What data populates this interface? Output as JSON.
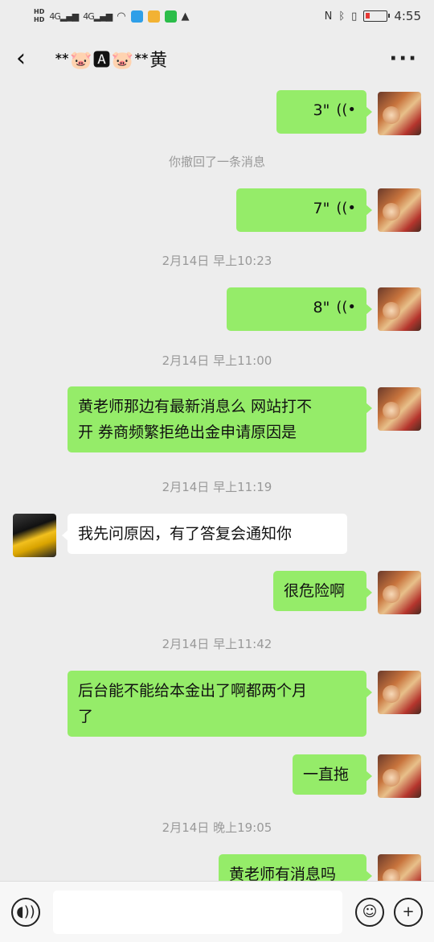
{
  "status_bar": {
    "hd_top": "HD",
    "hd_bottom": "HD",
    "net1": "4G",
    "net2": "4G",
    "nfc": "N",
    "bt": "ᛒ",
    "vibrate": "▯",
    "time": "4:55"
  },
  "header": {
    "title": "ᕯ🐷🅰🐷ᕯ黄"
  },
  "messages": [
    {
      "kind": "voice",
      "from": "me",
      "duration": "3\""
    },
    {
      "kind": "system",
      "text": "你撤回了一条消息"
    },
    {
      "kind": "voice",
      "from": "me",
      "duration": "7\""
    },
    {
      "kind": "system",
      "text": "2月14日 早上10:23"
    },
    {
      "kind": "voice",
      "from": "me",
      "duration": "8\""
    },
    {
      "kind": "system",
      "text": "2月14日 早上11:00"
    },
    {
      "kind": "text",
      "from": "me",
      "lines": [
        "黄老师那边有最新消息么 网站打不",
        "开 券商频繁拒绝出金申请原因是"
      ]
    },
    {
      "kind": "system",
      "text": "2月14日 早上11:19"
    },
    {
      "kind": "text",
      "from": "other",
      "lines": [
        "我先问原因，有了答复会通知你"
      ]
    },
    {
      "kind": "text",
      "from": "me",
      "lines": [
        "很危险啊"
      ]
    },
    {
      "kind": "system",
      "text": "2月14日 早上11:42"
    },
    {
      "kind": "text",
      "from": "me",
      "lines": [
        "后台能不能给本金出了啊都两个月",
        "了"
      ]
    },
    {
      "kind": "text",
      "from": "me",
      "lines": [
        "一直拖"
      ]
    },
    {
      "kind": "system",
      "text": "2月14日 晚上19:05"
    },
    {
      "kind": "text",
      "from": "me",
      "lines": [
        "黄老师有消息吗"
      ]
    }
  ],
  "input_bar": {
    "voice_icon": "voice-mode-icon",
    "emoji_icon": "emoji-icon",
    "plus_icon": "plus-icon"
  }
}
